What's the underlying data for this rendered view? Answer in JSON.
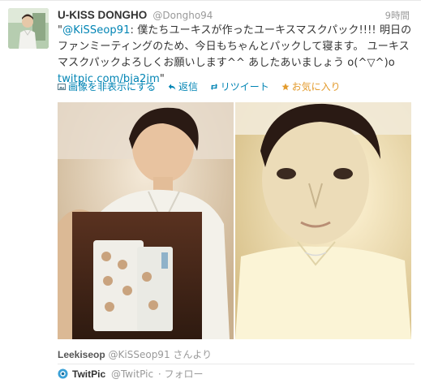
{
  "tweet": {
    "author_name": "U-KISS DONGHO",
    "author_handle": "@Dongho94",
    "timestamp": "9時間",
    "text_open_quote": "\"",
    "mention": "@KiSSeop91",
    "text_part1": ": 僕たちユーキスが作ったユーキスマスクパック!!!! 明日のファンミーティングのため、今日もちゃんとパックして寝ます。 ユーキスマスクパックよろしくお願いします^^ あしたあいましょう o(^▽^)o ",
    "link": "twitpic.com/bja2jm",
    "text_close_quote": "\""
  },
  "actions": [
    {
      "label": "画像を非表示にする",
      "icon": "image-icon"
    },
    {
      "label": "返信",
      "icon": "reply-icon"
    },
    {
      "label": "リツイート",
      "icon": "retweet-icon"
    },
    {
      "label": "お気に入り",
      "icon": "star-icon"
    }
  ],
  "media": {
    "credit_name": "Leekiseop",
    "credit_handle": "@KiSSeop91 さんより"
  },
  "provider": {
    "name": "TwitPic",
    "handle": "@TwitPic",
    "follow_label": "· フォロー",
    "icon": "twitpic-logo-icon"
  },
  "colors": {
    "link": "#0084b4",
    "favorite": "#e39b2d",
    "muted": "#999999",
    "text": "#333333"
  }
}
